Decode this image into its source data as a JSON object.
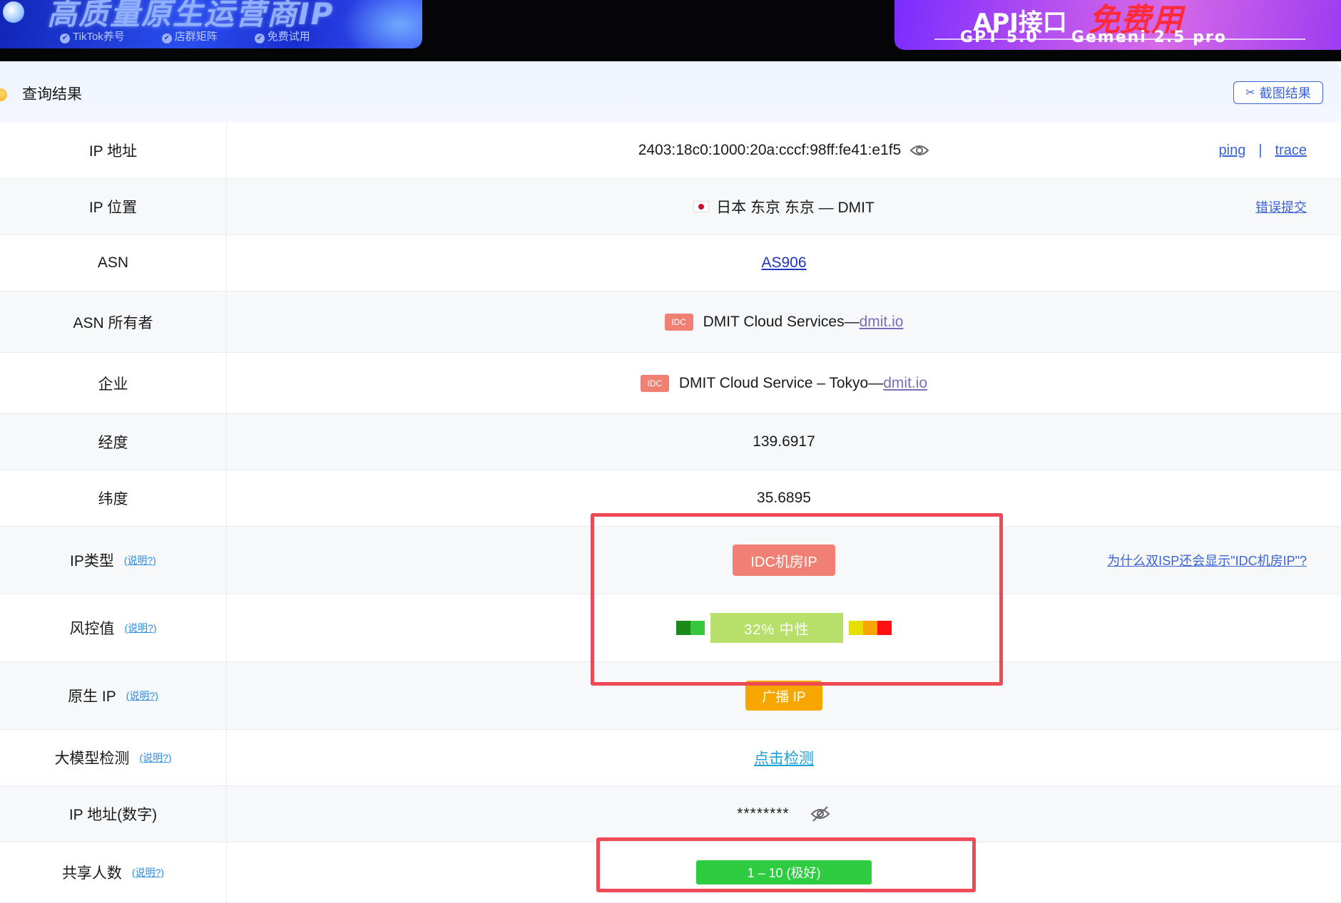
{
  "banners": {
    "left": {
      "title": "高质量原生运营商IP",
      "tags": [
        "TikTok养号",
        "店群矩阵",
        "免费试用"
      ]
    },
    "right": {
      "line1": "API接口",
      "line1_highlight": "免费用",
      "line2_left": "GPT 5.0",
      "line2_right": "Gemeni 2.5 pro"
    }
  },
  "header": {
    "title": "查询结果",
    "screenshot_button": "截图结果"
  },
  "help_label": "(说明?)",
  "rows": {
    "ip_address": {
      "label": "IP 地址",
      "value": "2403:18c0:1000:20a:cccf:98ff:fe41:e1f5",
      "ping": "ping",
      "separator": "|",
      "trace": "trace"
    },
    "ip_location": {
      "label": "IP 位置",
      "value": "日本 东京 东京 — DMIT",
      "report": "错误提交"
    },
    "asn": {
      "label": "ASN",
      "value": "AS906"
    },
    "asn_owner": {
      "label": "ASN 所有者",
      "badge": "IDC",
      "value": "DMIT Cloud Services—",
      "link": "dmit.io"
    },
    "company": {
      "label": "企业",
      "badge": "IDC",
      "value": "DMIT Cloud Service – Tokyo—",
      "link": "dmit.io"
    },
    "longitude": {
      "label": "经度",
      "value": "139.6917"
    },
    "latitude": {
      "label": "纬度",
      "value": "35.6895"
    },
    "ip_type": {
      "label": "IP类型",
      "badge": "IDC机房IP",
      "why_link": "为什么双ISP还会显示\"IDC机房IP\"?"
    },
    "risk": {
      "label": "风控值",
      "score_percent": 32,
      "value": "32%  中性",
      "colors": [
        "#1b8a1b",
        "#36c83c",
        "#b7e06b",
        "#e6e000",
        "#f7a600",
        "#ff1010"
      ]
    },
    "native_ip": {
      "label": "原生 IP",
      "badge": "广播 IP"
    },
    "llm_check": {
      "label": "大模型检测",
      "link": "点击检测"
    },
    "ip_numeric": {
      "label": "IP 地址(数字)",
      "value": "********"
    },
    "share_count": {
      "label": "共享人数",
      "badge": "1 – 10 (极好)"
    }
  }
}
